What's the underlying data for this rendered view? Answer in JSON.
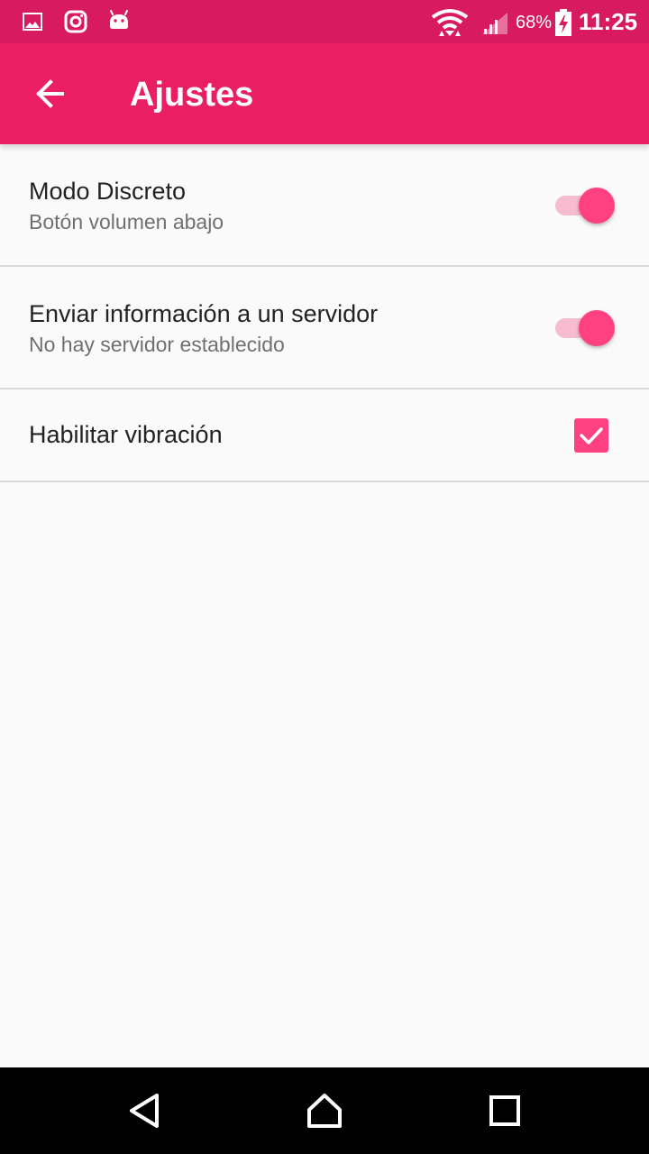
{
  "status_bar": {
    "battery_percent": "68%",
    "time": "11:25",
    "icons": [
      "gallery-icon",
      "instagram-icon",
      "android-icon",
      "wifi-icon",
      "signal-icon",
      "battery-charging-icon"
    ],
    "background_color": "#d81b60"
  },
  "app_bar": {
    "title": "Ajustes",
    "back_icon": "arrow-left-icon",
    "background_color": "#e91e63"
  },
  "settings": [
    {
      "title": "Modo Discreto",
      "subtitle": "Botón volumen abajo",
      "control": "switch",
      "checked": true
    },
    {
      "title": "Enviar información a un servidor",
      "subtitle": "No hay servidor establecido",
      "control": "switch",
      "checked": true
    },
    {
      "title": "Habilitar vibración",
      "control": "checkbox",
      "checked": true
    }
  ],
  "navigation_bar": {
    "buttons": [
      "back-icon",
      "home-icon",
      "recent-apps-icon"
    ]
  },
  "accent_color": "#ff4081"
}
